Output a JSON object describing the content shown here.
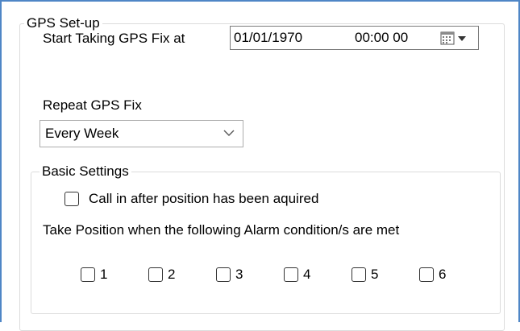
{
  "gps_setup": {
    "title": "GPS Set-up",
    "start_label": "Start Taking GPS Fix at",
    "start_date": "01/01/1970",
    "start_time": "00:00 00",
    "repeat_label": "Repeat GPS Fix",
    "repeat_value": "Every Week"
  },
  "basic_settings": {
    "title": "Basic Settings",
    "call_in_label": "Call in after position has been aquired",
    "call_in_checked": false,
    "alarm_label": "Take Position when the following Alarm condition/s are met",
    "alarms": [
      "1",
      "2",
      "3",
      "4",
      "5",
      "6"
    ]
  },
  "colors": {
    "frame_border": "#4f86c6",
    "group_border": "#dcdcdc"
  }
}
